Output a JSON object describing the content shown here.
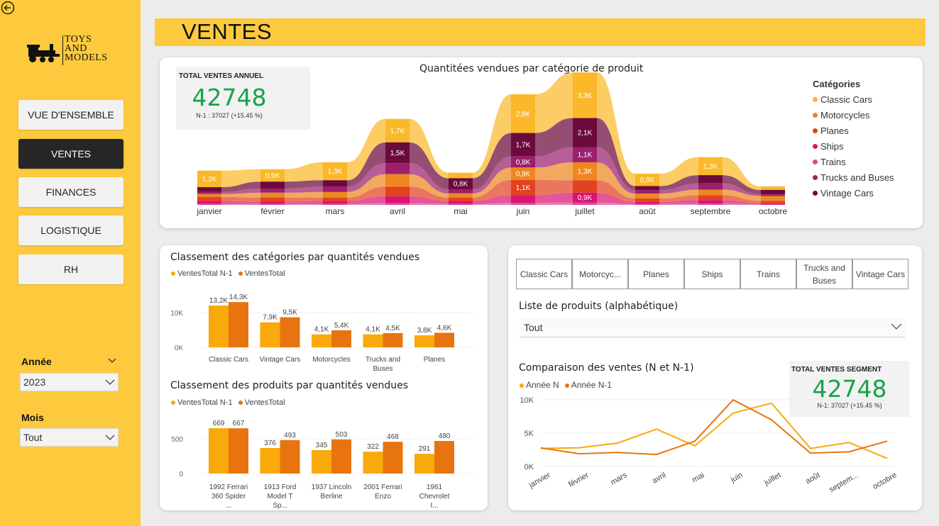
{
  "sidebar": {
    "logo_text": [
      "Toys",
      "and",
      "Models"
    ],
    "nav": [
      {
        "label": "VUE D'ENSEMBLE",
        "active": false
      },
      {
        "label": "VENTES",
        "active": true
      },
      {
        "label": "FINANCES",
        "active": false
      },
      {
        "label": "LOGISTIQUE",
        "active": false
      },
      {
        "label": "RH",
        "active": false
      }
    ],
    "filters": {
      "year_label": "Année",
      "year_value": "2023",
      "month_label": "Mois",
      "month_value": "Tout"
    }
  },
  "header": {
    "title": "VENTES"
  },
  "colors": {
    "accent_yellow": "#fdca3e",
    "kpi_green": "#17a34a",
    "classic_cars": "#fbb82a",
    "motorcycles": "#ef8721",
    "planes": "#e2421f",
    "ships": "#d91472",
    "trains": "#e0459c",
    "trucks_buses": "#9c1f6e",
    "vintage_cars": "#6b0a3c",
    "bar_n1": "#f9a90a",
    "bar_n": "#e8740f"
  },
  "kpi_total": {
    "title": "TOTAL VENTES ANNUEL",
    "value": "42748",
    "sub": "N-1 : 37027 (+15.45 %)"
  },
  "ribbon_chart": {
    "title": "Quantitées vendues par catégorie de produit",
    "legend_title": "Catégories"
  },
  "left_card": {
    "cat_title": "Classement des catégories par quantités vendues",
    "prod_title": "Classement des produits par quantités vendues",
    "legend": [
      "VentesTotal N-1",
      "VentesTotal"
    ]
  },
  "right_card": {
    "slicer": [
      "Classic Cars",
      "Motorcyc...",
      "Planes",
      "Ships",
      "Trains",
      "Trucks and Buses",
      "Vintage Cars"
    ],
    "product_list_label": "Liste de produits (alphabétique)",
    "product_list_value": "Tout",
    "compare_title": "Comparaison des ventes (N et N-1)",
    "compare_legend": [
      "Année N",
      "Année N-1"
    ],
    "kpi_segment": {
      "title": "TOTAL VENTES SEGMENT",
      "value": "42748",
      "sub": "N-1: 37027 (+15.45 %)"
    }
  },
  "chart_data": [
    {
      "type": "area",
      "title": "Quantitées vendues par catégorie de produit",
      "categories": [
        "janvier",
        "février",
        "mars",
        "avril",
        "mai",
        "juin",
        "juillet",
        "août",
        "septembre",
        "octobre"
      ],
      "series": [
        {
          "name": "Classic Cars",
          "values": [
            1200,
            900,
            1300,
            1700,
            400,
            2800,
            3300,
            900,
            1300,
            250
          ]
        },
        {
          "name": "Vintage Cars",
          "values": [
            350,
            500,
            450,
            1500,
            800,
            1700,
            2100,
            300,
            600,
            320
          ]
        },
        {
          "name": "Trucks and Buses",
          "values": [
            150,
            300,
            400,
            800,
            300,
            800,
            1100,
            250,
            450,
            120
          ]
        },
        {
          "name": "Motorcycles",
          "values": [
            200,
            350,
            400,
            900,
            300,
            900,
            1300,
            350,
            400,
            350
          ]
        },
        {
          "name": "Planes",
          "values": [
            300,
            300,
            250,
            700,
            250,
            1100,
            900,
            250,
            350,
            180
          ]
        },
        {
          "name": "Ships",
          "values": [
            200,
            150,
            200,
            500,
            200,
            550,
            700,
            150,
            250,
            80
          ]
        },
        {
          "name": "Trains",
          "values": [
            80,
            80,
            80,
            120,
            80,
            150,
            180,
            60,
            100,
            30
          ]
        }
      ],
      "data_labels": {
        "Classic Cars": [
          "1,2K",
          "0,9K",
          "1,3K",
          "1,7K",
          "",
          "2,8K",
          "3,3K",
          "0,9K",
          "1,3K",
          ""
        ],
        "Vintage Cars": [
          "",
          "",
          "",
          "1,5K",
          "0,8K",
          "1,7K",
          "2,1K",
          "",
          "",
          ""
        ],
        "Planes": [
          "",
          "",
          "",
          "",
          "",
          "1,1K",
          "",
          "",
          "",
          ""
        ],
        "Motorcycles": [
          "",
          "",
          "",
          "",
          "",
          "0,9K",
          "1,3K",
          "",
          "",
          ""
        ],
        "Trucks and Buses": [
          "",
          "",
          "",
          "",
          "",
          "0,8K",
          "1,1K",
          "",
          "",
          ""
        ],
        "Ships": [
          "",
          "",
          "",
          "",
          "",
          "",
          "0,9K",
          "",
          "",
          ""
        ]
      }
    },
    {
      "type": "bar",
      "title": "Classement des catégories par quantités vendues",
      "categories": [
        "Classic Cars",
        "Vintage Cars",
        "Motorcycles",
        "Trucks and Buses",
        "Planes"
      ],
      "series": [
        {
          "name": "VentesTotal N-1",
          "values": [
            13200,
            7900,
            4100,
            4100,
            3800
          ],
          "labels": [
            "13,2K",
            "7,9K",
            "4,1K",
            "4,1K",
            "3,8K"
          ]
        },
        {
          "name": "VentesTotal",
          "values": [
            14300,
            9500,
            5400,
            4500,
            4600
          ],
          "labels": [
            "14,3K",
            "9,5K",
            "5,4K",
            "4,5K",
            "4,6K"
          ]
        }
      ],
      "yticks": [
        "10K",
        "0K"
      ],
      "ylim": [
        0,
        15000
      ]
    },
    {
      "type": "bar",
      "title": "Classement des produits par quantités vendues",
      "categories": [
        "1992 Ferrari 360 Spider ...",
        "1913 Ford Model T Sp...",
        "1937 Lincoln Berline",
        "2001 Ferrari Enzo",
        "1961 Chevrolet I..."
      ],
      "series": [
        {
          "name": "VentesTotal N-1",
          "values": [
            669,
            376,
            345,
            322,
            291
          ],
          "labels": [
            "669",
            "376",
            "345",
            "322",
            "291"
          ]
        },
        {
          "name": "VentesTotal",
          "values": [
            667,
            493,
            503,
            468,
            480
          ],
          "labels": [
            "667",
            "493",
            "503",
            "468",
            "480"
          ]
        }
      ],
      "yticks": [
        "500",
        "0"
      ],
      "ylim": [
        0,
        700
      ]
    },
    {
      "type": "line",
      "title": "Comparaison des ventes (N et N-1)",
      "categories": [
        "janvier",
        "février",
        "mars",
        "avril",
        "mai",
        "juin",
        "juillet",
        "août",
        "septem...",
        "octobre"
      ],
      "series": [
        {
          "name": "Année N",
          "values": [
            2700,
            2800,
            3500,
            5600,
            3100,
            8000,
            9500,
            2700,
            3600,
            1200
          ]
        },
        {
          "name": "Année N-1",
          "values": [
            2800,
            1900,
            2100,
            1800,
            3800,
            10000,
            7000,
            2000,
            2200,
            3800
          ]
        }
      ],
      "yticks": [
        "10K",
        "5K",
        "0K"
      ],
      "ylim": [
        0,
        10000
      ]
    }
  ]
}
